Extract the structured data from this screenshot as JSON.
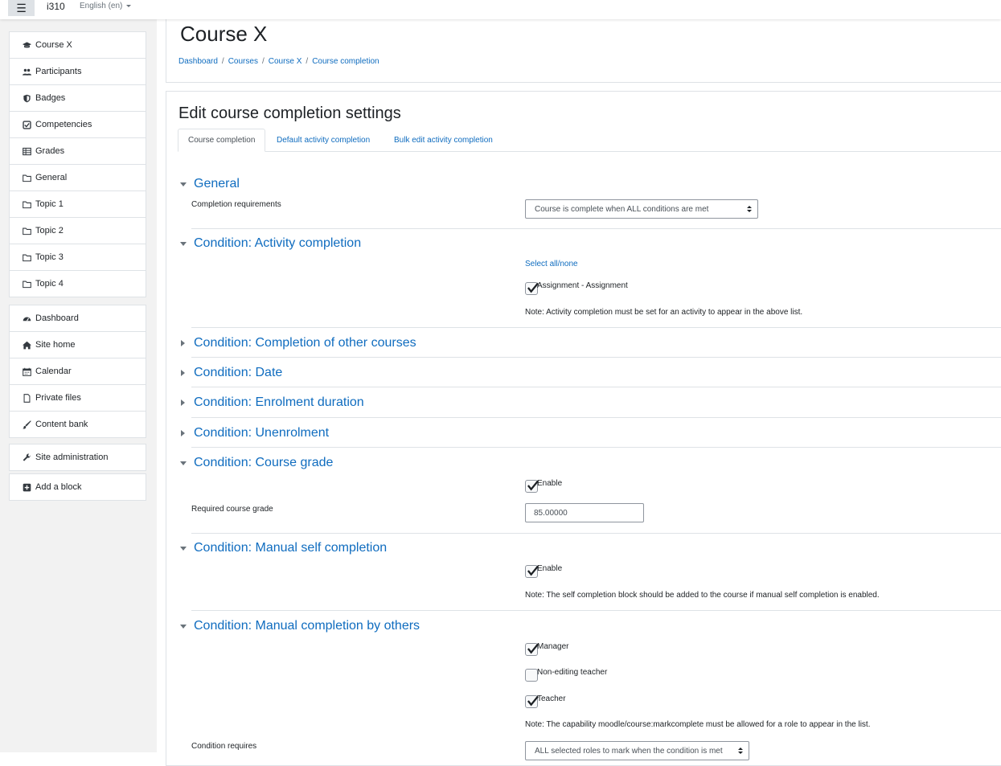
{
  "navbar": {
    "menu_icon": "hamburger-icon",
    "site_name": "i310",
    "language": "English (en)"
  },
  "drawer": {
    "course_nav": [
      {
        "label": "Course X",
        "icon": "graduation-cap-icon"
      },
      {
        "label": "Participants",
        "icon": "users-icon"
      },
      {
        "label": "Badges",
        "icon": "shield-icon"
      },
      {
        "label": "Competencies",
        "icon": "check-square-icon"
      },
      {
        "label": "Grades",
        "icon": "table-icon"
      },
      {
        "label": "General",
        "icon": "folder-icon"
      },
      {
        "label": "Topic 1",
        "icon": "folder-icon"
      },
      {
        "label": "Topic 2",
        "icon": "folder-icon"
      },
      {
        "label": "Topic 3",
        "icon": "folder-icon"
      },
      {
        "label": "Topic 4",
        "icon": "folder-icon"
      }
    ],
    "site_nav": [
      {
        "label": "Dashboard",
        "icon": "tachometer-icon"
      },
      {
        "label": "Site home",
        "icon": "home-icon"
      },
      {
        "label": "Calendar",
        "icon": "calendar-icon"
      },
      {
        "label": "Private files",
        "icon": "file-icon"
      },
      {
        "label": "Content bank",
        "icon": "paintbrush-icon"
      }
    ],
    "admin_nav": [
      {
        "label": "Site administration",
        "icon": "wrench-icon"
      }
    ],
    "block_nav": [
      {
        "label": "Add a block",
        "icon": "plus-square-icon"
      }
    ]
  },
  "header": {
    "title": "Course X",
    "breadcrumb": [
      "Dashboard",
      "Courses",
      "Course X",
      "Course completion"
    ]
  },
  "main": {
    "heading": "Edit course completion settings",
    "tabs": [
      "Course completion",
      "Default activity completion",
      "Bulk edit activity completion"
    ],
    "active_tab": "Course completion",
    "sections": {
      "general": {
        "title": "General",
        "expanded": true,
        "completion_requirements_label": "Completion requirements",
        "completion_requirements_value": "Course is complete when ALL conditions are met"
      },
      "activity": {
        "title": "Condition: Activity completion",
        "expanded": true,
        "select_all": "Select all/none",
        "items": [
          {
            "label": "Assignment - Assignment",
            "checked": true
          }
        ],
        "note": "Note: Activity completion must be set for an activity to appear in the above list."
      },
      "other_courses": {
        "title": "Condition: Completion of other courses",
        "expanded": false
      },
      "date": {
        "title": "Condition: Date",
        "expanded": false
      },
      "enrolment": {
        "title": "Condition: Enrolment duration",
        "expanded": false
      },
      "unenrolment": {
        "title": "Condition: Unenrolment",
        "expanded": false
      },
      "grade": {
        "title": "Condition: Course grade",
        "expanded": true,
        "enable_label": "Enable",
        "enable_checked": true,
        "required_label": "Required course grade",
        "required_value": "85.00000"
      },
      "self": {
        "title": "Condition: Manual self completion",
        "expanded": true,
        "enable_label": "Enable",
        "enable_checked": true,
        "note": "Note: The self completion block should be added to the course if manual self completion is enabled."
      },
      "others": {
        "title": "Condition: Manual completion by others",
        "expanded": true,
        "roles": [
          {
            "label": "Manager",
            "checked": true
          },
          {
            "label": "Non-editing teacher",
            "checked": false
          },
          {
            "label": "Teacher",
            "checked": true
          }
        ],
        "note": "Note: The capability moodle/course:markcomplete must be allowed for a role to appear in the list.",
        "requires_label": "Condition requires",
        "requires_value": "ALL selected roles to mark when the condition is met"
      }
    }
  },
  "colors": {
    "link": "#0f6cbf",
    "drawer_bg": "#f2f2f2",
    "border": "#dee2e6"
  }
}
